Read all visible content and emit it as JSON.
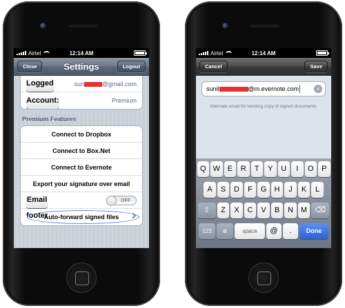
{
  "status_bar": {
    "carrier": "Airtel",
    "time": "12:14 AM"
  },
  "settings": {
    "title": "Settings",
    "close_label": "Close",
    "logout_label": "Logout",
    "logged_in_label": "Logged in:",
    "logged_in_prefix": "sun",
    "logged_in_suffix": "@gmail.com",
    "account_label": "Account:",
    "account_value": "Premium",
    "premium_header": "Premium Features",
    "connect_dropbox": "Connect to Dropbox",
    "connect_box": "Connect to Box.Net",
    "connect_evernote": "Connect to Evernote",
    "export_signature": "Export your signature over email",
    "email_footer_label": "Email footer",
    "email_footer_toggle": "OFF",
    "auto_forward": "Auto-forward signed files"
  },
  "email_screen": {
    "cancel_label": "Cancel",
    "save_label": "Save",
    "email_prefix": "sunil",
    "email_suffix": "@m.evernote.com",
    "hint": "Alternate email for sending copy of signed documents."
  },
  "keyboard": {
    "row1": [
      "Q",
      "W",
      "E",
      "R",
      "T",
      "Y",
      "U",
      "I",
      "O",
      "P"
    ],
    "row2": [
      "A",
      "S",
      "D",
      "F",
      "G",
      "H",
      "J",
      "K",
      "L"
    ],
    "row3": [
      "Z",
      "X",
      "C",
      "V",
      "B",
      "N",
      "M"
    ],
    "numbers_label": "123",
    "space_label": "space",
    "at_label": "@",
    "dot_label": ".",
    "done_label": "Done"
  },
  "colors": {
    "highlight_ellipse": "#4e84d8",
    "redaction": "#e83030",
    "save_button": "#356ad6"
  }
}
